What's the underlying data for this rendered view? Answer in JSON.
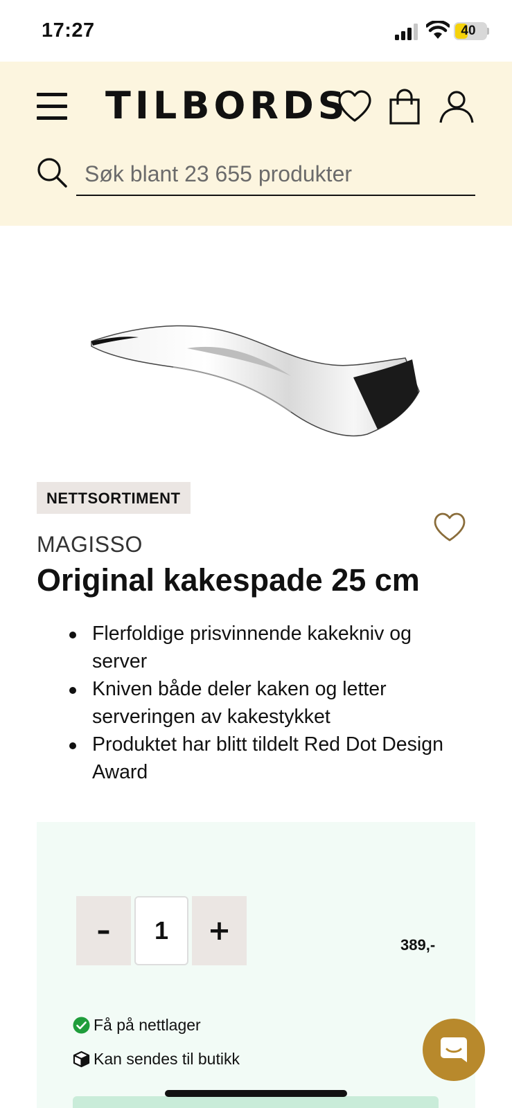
{
  "status_bar": {
    "time": "17:27",
    "battery_level": "40",
    "battery_fraction": 0.4,
    "icons": [
      "cellular-signal-icon",
      "wifi-icon",
      "battery-icon"
    ]
  },
  "header": {
    "logo_text": "TILBORDS",
    "icons": [
      "hamburger-menu-icon",
      "heart-icon",
      "shopping-bag-icon",
      "user-icon"
    ],
    "search": {
      "placeholder": "Søk blant 23 655 produkter",
      "value": ""
    }
  },
  "product": {
    "badge": "NETTSORTIMENT",
    "brand": "MAGISSO",
    "title": "Original kakespade 25 cm",
    "features": [
      "Flerfoldige prisvinnende kakekniv og server",
      "Kniven både deler kaken og letter serveringen av kakestykket",
      "Produktet har blitt tildelt Red Dot Design Award"
    ]
  },
  "buy_panel": {
    "quantity": "1",
    "minus_label": "–",
    "plus_label": "+",
    "price": "389,-",
    "stock_online": "Få på nettlager",
    "ship_to_store": "Kan sendes til butikk"
  },
  "colors": {
    "header_bg": "#fcf5df",
    "panel_bg": "#f2fbf6",
    "badge_bg": "#ebe6e3",
    "accent_gold": "#b8892c",
    "in_stock_green": "#1f9d3b",
    "cta_green": "#c9ecd9"
  }
}
